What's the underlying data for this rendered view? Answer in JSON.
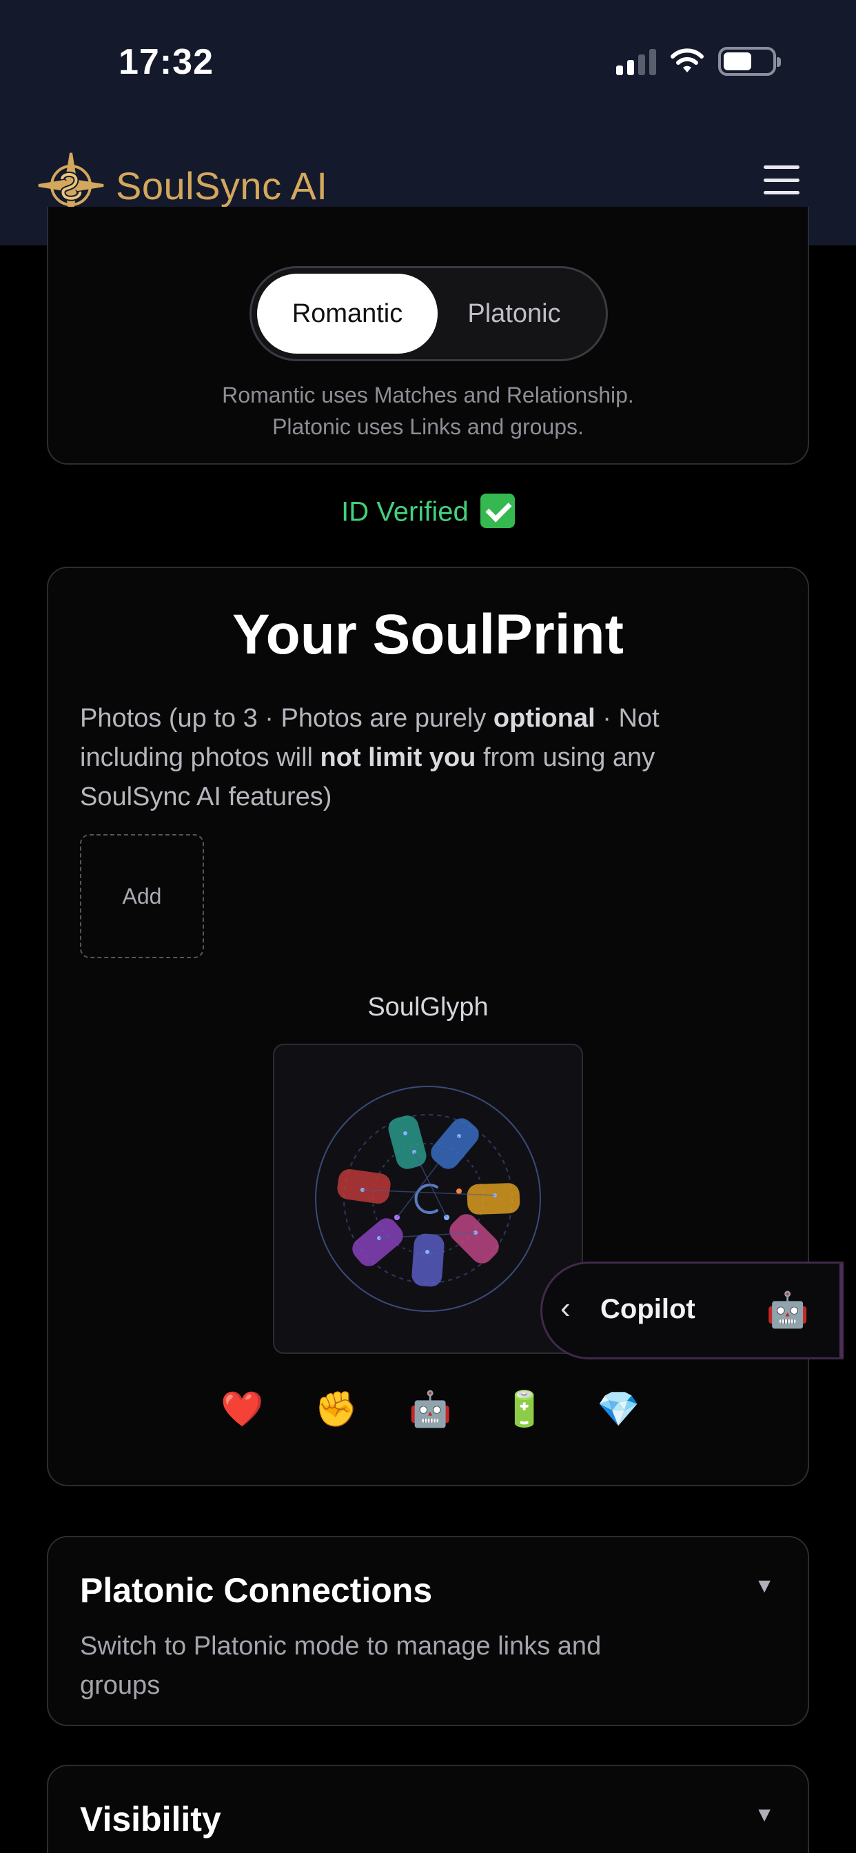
{
  "status_bar": {
    "time": "17:32"
  },
  "header": {
    "app_name": "SoulSync AI",
    "accent_color": "#d4a85c"
  },
  "mode_selector": {
    "options": [
      "Romantic",
      "Platonic"
    ],
    "selected": "Romantic",
    "description_line1": "Romantic uses Matches and Relationship.",
    "description_line2": "Platonic uses Links and groups."
  },
  "verification": {
    "label": "ID Verified",
    "icon": "check-mark-icon",
    "color": "#44d17a"
  },
  "soulprint": {
    "title": "Your SoulPrint",
    "desc_part1": "Photos (up to 3 · Photos are purely ",
    "desc_bold1": "optional",
    "desc_part2": " · Not including photos will ",
    "desc_bold2": "not limit you",
    "desc_part3": " from using any SoulSync AI features)",
    "add_photo_label": "Add",
    "glyph_label": "SoulGlyph",
    "trait_icons": [
      "❤️",
      "✊",
      "🤖",
      "🔋",
      "💎"
    ]
  },
  "copilot": {
    "chevron": "‹",
    "label": "Copilot",
    "icon": "🤖"
  },
  "sections": [
    {
      "title": "Platonic Connections",
      "description": "Switch to Platonic mode to manage links and groups",
      "arrow": "▼"
    },
    {
      "title": "Visibility",
      "arrow": "▼"
    }
  ]
}
